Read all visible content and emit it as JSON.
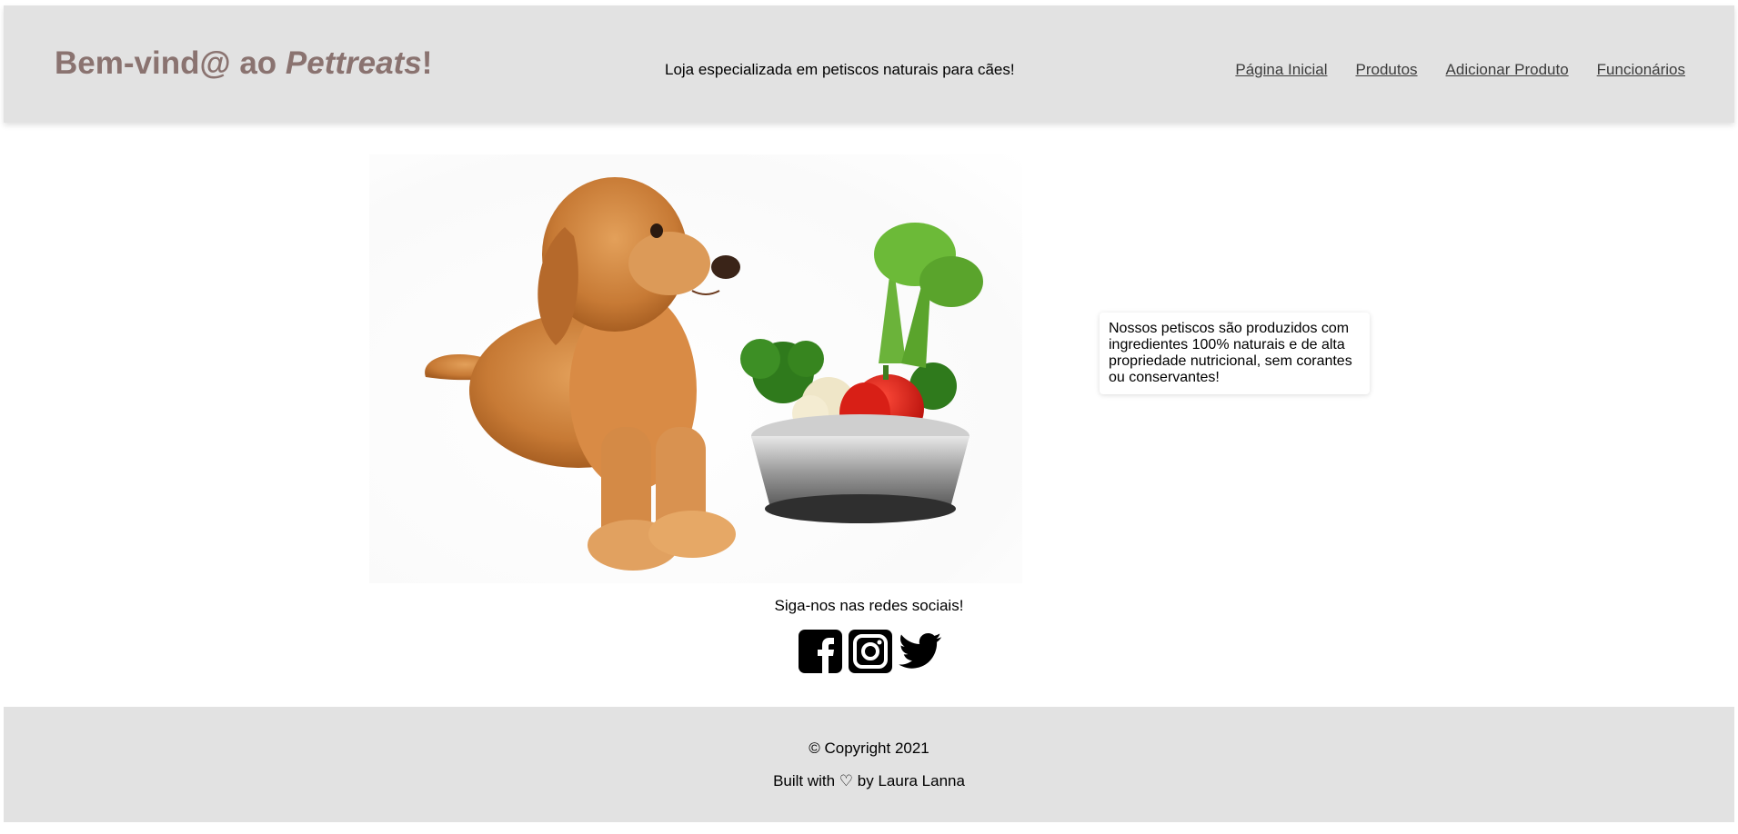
{
  "header": {
    "brand_prefix": "Bem-vind@ ao ",
    "brand_name": "Pettreats",
    "brand_suffix": "!",
    "tagline": "Loja especializada em petiscos naturais para cães!",
    "nav": [
      {
        "label": "Página Inicial"
      },
      {
        "label": "Produtos"
      },
      {
        "label": "Adicionar Produto"
      },
      {
        "label": "Funcionários"
      }
    ]
  },
  "hero": {
    "image": "golden-retriever-with-vegetable-bowl",
    "info_text": "Nossos petiscos são produzidos com ingredientes 100% naturais e de alta propriedade nutricional, sem corantes ou conservantes!"
  },
  "social": {
    "title": "Siga-nos nas redes sociais!",
    "icons": [
      "facebook-icon",
      "instagram-icon",
      "twitter-icon"
    ]
  },
  "footer": {
    "copyright": "© Copyright 2021",
    "built_with": "Built with ♡ by Laura Lanna"
  },
  "colors": {
    "header_bg": "#e2e2e2",
    "brand": "#8a7370",
    "footer_bg": "#e2e2e2"
  }
}
